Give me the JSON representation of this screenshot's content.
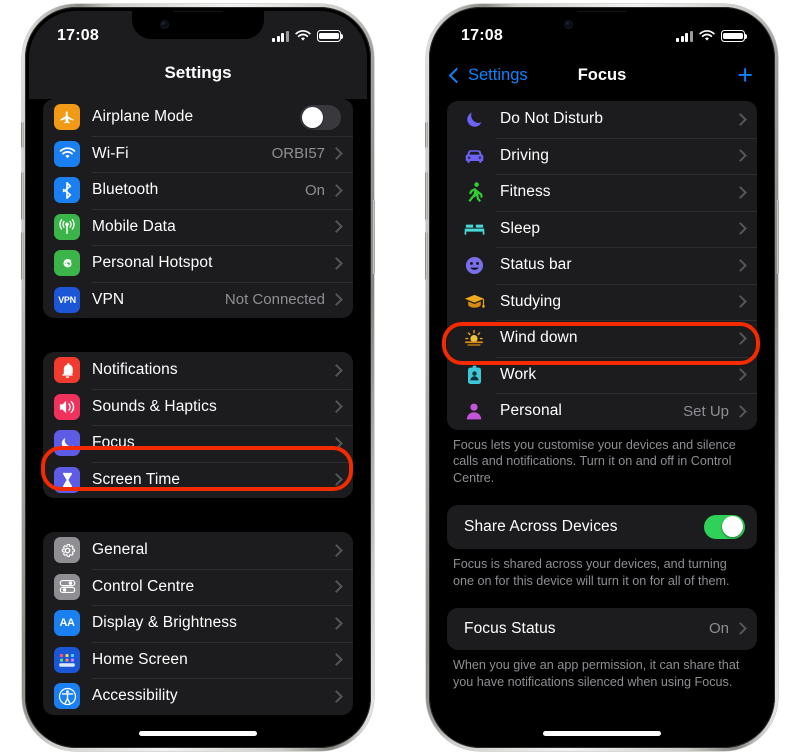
{
  "colors": {
    "accent_blue": "#0a84ff",
    "highlight_red": "#f42a00",
    "toggle_on_green": "#30d158",
    "group_bg": "#1c1c1e",
    "secondary_text": "#8e8e93"
  },
  "left_phone": {
    "status_bar": {
      "time": "17:08",
      "signal": "signal-bars-icon",
      "wifi": "wifi-icon",
      "battery": "battery-full-icon"
    },
    "nav": {
      "title": "Settings"
    },
    "group1": [
      {
        "label": "Airplane Mode",
        "icon": "airplane-icon",
        "icon_color": "#f09a17",
        "control": "toggle",
        "toggle_on": false
      },
      {
        "label": "Wi-Fi",
        "icon": "wifi-icon",
        "icon_color": "#1a7ff0",
        "value": "ORBI57",
        "control": "chevron"
      },
      {
        "label": "Bluetooth",
        "icon": "bluetooth-icon",
        "icon_color": "#1a7ff0",
        "value": "On",
        "control": "chevron"
      },
      {
        "label": "Mobile Data",
        "icon": "antenna-icon",
        "icon_color": "#3bb54a",
        "value": "",
        "control": "chevron"
      },
      {
        "label": "Personal Hotspot",
        "icon": "hotspot-icon",
        "icon_color": "#3bb54a",
        "value": "",
        "control": "chevron"
      },
      {
        "label": "VPN",
        "icon": "vpn-icon",
        "icon_color": "#1a56d6",
        "value": "Not Connected",
        "control": "chevron"
      }
    ],
    "group2": [
      {
        "label": "Notifications",
        "icon": "bell-icon",
        "icon_color": "#f03b2e",
        "value": "",
        "control": "chevron"
      },
      {
        "label": "Sounds & Haptics",
        "icon": "speaker-icon",
        "icon_color": "#f0325c",
        "value": "",
        "control": "chevron"
      },
      {
        "label": "Focus",
        "icon": "moon-icon",
        "icon_color": "#5e5ce6",
        "value": "",
        "control": "chevron",
        "highlighted": true
      },
      {
        "label": "Screen Time",
        "icon": "hourglass-icon",
        "icon_color": "#5e5ce6",
        "value": "",
        "control": "chevron"
      }
    ],
    "group3": [
      {
        "label": "General",
        "icon": "gear-icon",
        "icon_color": "#8e8e93",
        "value": "",
        "control": "chevron"
      },
      {
        "label": "Control Centre",
        "icon": "control-centre-icon",
        "icon_color": "#8e8e93",
        "value": "",
        "control": "chevron"
      },
      {
        "label": "Display & Brightness",
        "icon": "display-brightness-icon",
        "icon_color": "#1a7ff0",
        "value": "",
        "control": "chevron"
      },
      {
        "label": "Home Screen",
        "icon": "home-screen-icon",
        "icon_color": "#1a56d6",
        "value": "",
        "control": "chevron"
      },
      {
        "label": "Accessibility",
        "icon": "accessibility-icon",
        "icon_color": "#1a7ff0",
        "value": "",
        "control": "chevron"
      }
    ]
  },
  "right_phone": {
    "status_bar": {
      "time": "17:08",
      "signal": "signal-bars-icon",
      "wifi": "wifi-icon",
      "battery": "battery-full-icon"
    },
    "nav": {
      "back_label": "Settings",
      "title": "Focus",
      "add_label": "+"
    },
    "focus_modes": [
      {
        "label": "Do Not Disturb",
        "icon": "moon-icon",
        "icon_color": "#6c63f5",
        "value": ""
      },
      {
        "label": "Driving",
        "icon": "car-icon",
        "icon_color": "#6c63f5",
        "value": ""
      },
      {
        "label": "Fitness",
        "icon": "running-icon",
        "icon_color": "#2fd02f",
        "value": ""
      },
      {
        "label": "Sleep",
        "icon": "bed-icon",
        "icon_color": "#48d8d8",
        "value": ""
      },
      {
        "label": "Status bar",
        "icon": "smiley-icon",
        "icon_color": "#7a6fe8",
        "value": ""
      },
      {
        "label": "Studying",
        "icon": "graduation-cap-icon",
        "icon_color": "#f0a81e",
        "value": "",
        "highlighted": true
      },
      {
        "label": "Wind down",
        "icon": "sunset-icon",
        "icon_color": "#e8a020",
        "value": ""
      },
      {
        "label": "Work",
        "icon": "id-badge-icon",
        "icon_color": "#3ec7d8",
        "value": ""
      },
      {
        "label": "Personal",
        "icon": "person-icon",
        "icon_color": "#c255d8",
        "value": "Set Up"
      }
    ],
    "focus_note": "Focus lets you customise your devices and silence calls and notifications. Turn it on and off in Control Centre.",
    "share_row": {
      "label": "Share Across Devices",
      "toggle_on": true
    },
    "share_note": "Focus is shared across your devices, and turning one on for this device will turn it on for all of them.",
    "status_row": {
      "label": "Focus Status",
      "value": "On"
    },
    "status_note": "When you give an app permission, it can share that you have notifications silenced when using Focus."
  }
}
